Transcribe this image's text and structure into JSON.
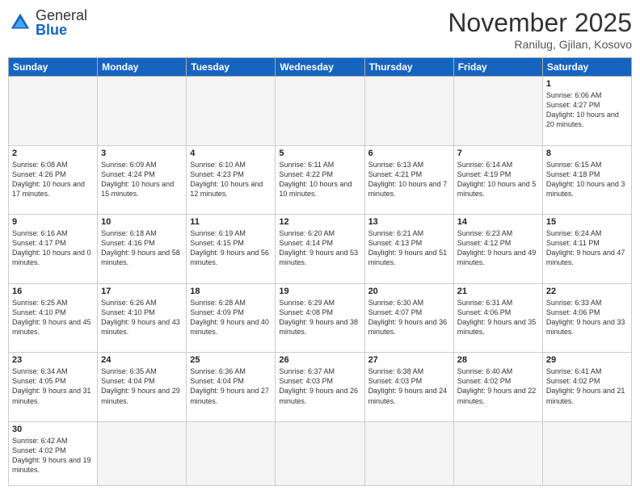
{
  "header": {
    "logo_general": "General",
    "logo_blue": "Blue",
    "month_title": "November 2025",
    "location": "Ranilug, Gjilan, Kosovo"
  },
  "days_of_week": [
    "Sunday",
    "Monday",
    "Tuesday",
    "Wednesday",
    "Thursday",
    "Friday",
    "Saturday"
  ],
  "weeks": [
    [
      {
        "day": "",
        "info": ""
      },
      {
        "day": "",
        "info": ""
      },
      {
        "day": "",
        "info": ""
      },
      {
        "day": "",
        "info": ""
      },
      {
        "day": "",
        "info": ""
      },
      {
        "day": "",
        "info": ""
      },
      {
        "day": "1",
        "info": "Sunrise: 6:06 AM\nSunset: 4:27 PM\nDaylight: 10 hours and 20 minutes."
      }
    ],
    [
      {
        "day": "2",
        "info": "Sunrise: 6:08 AM\nSunset: 4:26 PM\nDaylight: 10 hours and 17 minutes."
      },
      {
        "day": "3",
        "info": "Sunrise: 6:09 AM\nSunset: 4:24 PM\nDaylight: 10 hours and 15 minutes."
      },
      {
        "day": "4",
        "info": "Sunrise: 6:10 AM\nSunset: 4:23 PM\nDaylight: 10 hours and 12 minutes."
      },
      {
        "day": "5",
        "info": "Sunrise: 6:11 AM\nSunset: 4:22 PM\nDaylight: 10 hours and 10 minutes."
      },
      {
        "day": "6",
        "info": "Sunrise: 6:13 AM\nSunset: 4:21 PM\nDaylight: 10 hours and 7 minutes."
      },
      {
        "day": "7",
        "info": "Sunrise: 6:14 AM\nSunset: 4:19 PM\nDaylight: 10 hours and 5 minutes."
      },
      {
        "day": "8",
        "info": "Sunrise: 6:15 AM\nSunset: 4:18 PM\nDaylight: 10 hours and 3 minutes."
      }
    ],
    [
      {
        "day": "9",
        "info": "Sunrise: 6:16 AM\nSunset: 4:17 PM\nDaylight: 10 hours and 0 minutes."
      },
      {
        "day": "10",
        "info": "Sunrise: 6:18 AM\nSunset: 4:16 PM\nDaylight: 9 hours and 58 minutes."
      },
      {
        "day": "11",
        "info": "Sunrise: 6:19 AM\nSunset: 4:15 PM\nDaylight: 9 hours and 56 minutes."
      },
      {
        "day": "12",
        "info": "Sunrise: 6:20 AM\nSunset: 4:14 PM\nDaylight: 9 hours and 53 minutes."
      },
      {
        "day": "13",
        "info": "Sunrise: 6:21 AM\nSunset: 4:13 PM\nDaylight: 9 hours and 51 minutes."
      },
      {
        "day": "14",
        "info": "Sunrise: 6:23 AM\nSunset: 4:12 PM\nDaylight: 9 hours and 49 minutes."
      },
      {
        "day": "15",
        "info": "Sunrise: 6:24 AM\nSunset: 4:11 PM\nDaylight: 9 hours and 47 minutes."
      }
    ],
    [
      {
        "day": "16",
        "info": "Sunrise: 6:25 AM\nSunset: 4:10 PM\nDaylight: 9 hours and 45 minutes."
      },
      {
        "day": "17",
        "info": "Sunrise: 6:26 AM\nSunset: 4:10 PM\nDaylight: 9 hours and 43 minutes."
      },
      {
        "day": "18",
        "info": "Sunrise: 6:28 AM\nSunset: 4:09 PM\nDaylight: 9 hours and 40 minutes."
      },
      {
        "day": "19",
        "info": "Sunrise: 6:29 AM\nSunset: 4:08 PM\nDaylight: 9 hours and 38 minutes."
      },
      {
        "day": "20",
        "info": "Sunrise: 6:30 AM\nSunset: 4:07 PM\nDaylight: 9 hours and 36 minutes."
      },
      {
        "day": "21",
        "info": "Sunrise: 6:31 AM\nSunset: 4:06 PM\nDaylight: 9 hours and 35 minutes."
      },
      {
        "day": "22",
        "info": "Sunrise: 6:33 AM\nSunset: 4:06 PM\nDaylight: 9 hours and 33 minutes."
      }
    ],
    [
      {
        "day": "23",
        "info": "Sunrise: 6:34 AM\nSunset: 4:05 PM\nDaylight: 9 hours and 31 minutes."
      },
      {
        "day": "24",
        "info": "Sunrise: 6:35 AM\nSunset: 4:04 PM\nDaylight: 9 hours and 29 minutes."
      },
      {
        "day": "25",
        "info": "Sunrise: 6:36 AM\nSunset: 4:04 PM\nDaylight: 9 hours and 27 minutes."
      },
      {
        "day": "26",
        "info": "Sunrise: 6:37 AM\nSunset: 4:03 PM\nDaylight: 9 hours and 26 minutes."
      },
      {
        "day": "27",
        "info": "Sunrise: 6:38 AM\nSunset: 4:03 PM\nDaylight: 9 hours and 24 minutes."
      },
      {
        "day": "28",
        "info": "Sunrise: 6:40 AM\nSunset: 4:02 PM\nDaylight: 9 hours and 22 minutes."
      },
      {
        "day": "29",
        "info": "Sunrise: 6:41 AM\nSunset: 4:02 PM\nDaylight: 9 hours and 21 minutes."
      }
    ],
    [
      {
        "day": "30",
        "info": "Sunrise: 6:42 AM\nSunset: 4:02 PM\nDaylight: 9 hours and 19 minutes."
      },
      {
        "day": "",
        "info": ""
      },
      {
        "day": "",
        "info": ""
      },
      {
        "day": "",
        "info": ""
      },
      {
        "day": "",
        "info": ""
      },
      {
        "day": "",
        "info": ""
      },
      {
        "day": "",
        "info": ""
      }
    ]
  ]
}
